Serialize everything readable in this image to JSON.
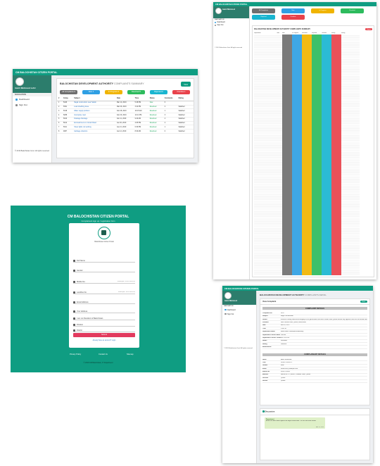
{
  "colors": {
    "brand": "#0f9d82",
    "gray": "#6f6f6f",
    "blue": "#2f9fe3",
    "yellow": "#f0b400",
    "green": "#2dbb5d",
    "cyan": "#19b5d0",
    "red": "#e8424b"
  },
  "app": {
    "title": "CM BALOCHISTAN CITIZEN PORTAL"
  },
  "panelA": {
    "user_name": "Aamir Mehmood Lehri",
    "menu_heading": "NAVIGATION",
    "menu": [
      "Dashboard",
      "Sign Out"
    ],
    "footer": "© 2019 Balochistan Govt. All rights reserved",
    "heading_main": "BALOCHISTAN DEVELOPMENT AUTHORITY",
    "heading_sub": "COMPLAINTS SUMMARY",
    "new_button": "New",
    "filters": [
      {
        "label": "All Complaints",
        "count": "9",
        "color": "#6f6f6f"
      },
      {
        "label": "New",
        "count": "1",
        "color": "#2f9fe3"
      },
      {
        "label": "In Progress",
        "count": "2",
        "color": "#f0b400"
      },
      {
        "label": "Resolved",
        "count": "5",
        "color": "#2dbb5d"
      },
      {
        "label": "Rejected",
        "count": "0",
        "color": "#19b5d0"
      },
      {
        "label": "Overdue",
        "count": "1",
        "color": "#e8424b"
      }
    ],
    "table": {
      "headers": [
        "#",
        "Comp.",
        "Subject",
        "Date",
        "Time",
        "Status",
        "Comments",
        "Rating"
      ],
      "rows": [
        [
          "1",
          "5426",
          "Illegal construction near Sariab",
          "Mar 14, 2019",
          "5:48 PM",
          "New",
          "0",
          ""
        ],
        [
          "2",
          "5391",
          "Load shedding issue",
          "Mar 09, 2019",
          "3:22 PM",
          "Resolved",
          "2",
          "Satisfied"
        ],
        [
          "3",
          "5318",
          "Water supply problem",
          "Feb 28, 2019",
          "10:15 AM",
          "Resolved",
          "1",
          "Satisfied"
        ],
        [
          "4",
          "5288",
          "Incomplete road",
          "Feb 20, 2019",
          "12:11 PM",
          "Resolved",
          "3",
          "Satisfied"
        ],
        [
          "5",
          "5190",
          "Drainage blockage",
          "Feb 11, 2019",
          "9:40 AM",
          "Resolved",
          "4",
          "Satisfied"
        ],
        [
          "6",
          "5102",
          "Encroachment on Jinnah Road",
          "Jan 30, 2019",
          "4:05 PM",
          "Resolved",
          "2",
          "Satisfied"
        ],
        [
          "7",
          "5011",
          "Street lights not working",
          "Jan 21, 2019",
          "6:30 PM",
          "Resolved",
          "1",
          "Satisfied"
        ],
        [
          "8",
          "4987",
          "Garbage collection",
          "Jan 12, 2019",
          "8:20 AM",
          "Resolved",
          "0",
          "Satisfied"
        ]
      ]
    }
  },
  "panelB": {
    "user_name": "Aamir Mehmood",
    "menu_heading": "NAVIGATION",
    "menu": [
      "Dashboard",
      "Sign Out"
    ],
    "footer": "© 2019 Balochistan Govt. All rights reserved",
    "filters": [
      {
        "label": "All Complaints",
        "color": "#6f6f6f"
      },
      {
        "label": "New",
        "color": "#2f9fe3"
      },
      {
        "label": "In Progress",
        "color": "#f0b400"
      },
      {
        "label": "Resolved",
        "color": "#2dbb5d"
      },
      {
        "label": "Rejected",
        "color": "#19b5d0"
      },
      {
        "label": "Overdue",
        "color": "#e8424b"
      }
    ],
    "heading": "BALOCHISTAN DEVELOPMENT AUTHORITY COMPLAINTS SUMMARY",
    "export_button": "Export",
    "columns": [
      "Department",
      "Total",
      "New",
      "In Progress",
      "Resolved",
      "Rejected",
      "Overdue",
      "Rating"
    ]
  },
  "panelC": {
    "title": "CM BALOCHISTAN CITIZEN PORTAL",
    "subtitle": "Complainant sign up / registration form",
    "logo_caption": "Balochistan Citizen Portal",
    "fields": [
      {
        "label": "Full Name",
        "value": ""
      },
      {
        "label": "Gender",
        "value": "Select Gender"
      },
      {
        "label": "Mobile No.",
        "value": "Example: 03xx-xxxxxxx"
      },
      {
        "label": "Landline No.",
        "value": "Example: 081-xxxxxxx"
      },
      {
        "label": "Email Address",
        "value": ""
      },
      {
        "label": "Your Address",
        "value": ""
      },
      {
        "label": "I am not Resident of Balochistan",
        "value": ""
      },
      {
        "label": "Division",
        "value": "Select Division"
      },
      {
        "label": "District",
        "value": "Select District"
      }
    ],
    "submit": "Submit",
    "already": "Already have an account? Login",
    "footer_links": [
      "Privacy Policy",
      "Contact Us",
      "Sitemap"
    ],
    "copyright": "© 2019 CM Balochistan, IT Department"
  },
  "panelD": {
    "user_name": "Aamir Mehmood",
    "menu_heading": "NAVIGATION",
    "menu": [
      "Dashboard",
      "Sign Out"
    ],
    "footer": "© 2019 Balochistan Govt. All rights reserved",
    "heading_main": "BALOCHISTAN DEVELOPMENT AUTHORITY",
    "heading_sub": "COMPLAINTS DETAIL",
    "view_title": "View Complaint",
    "back_button": "Back",
    "complaint_section": "COMPLAINT DETAILS",
    "complaint_rows": [
      [
        "Complaint No.",
        "5426"
      ],
      [
        "Subject",
        "Illegal Construction"
      ],
      [
        "Details",
        "A house is being constructed illegally on the government land near Sariab Road Quetta without any approval from the concerned authority. The construction is blocking the public way and needs immediate attention from BDA officials kindly take action as soon as possible."
      ],
      [
        "Location",
        "Near Sariab Road, Quetta, Balochistan"
      ],
      [
        "Date",
        "Mar 14, 2019"
      ],
      [
        "Time",
        "5:48 PM"
      ],
      [
        "Department Name",
        "Balochistan Development Authority"
      ],
      [
        "Department Officer Name",
        "Director"
      ],
      [
        "Department Officer Contact",
        "081-9201234"
      ],
      [
        "Status",
        "Resolved"
      ],
      [
        "Rating",
        "Satisfied"
      ],
      [
        "Attachments",
        ""
      ]
    ],
    "complainant_section": "COMPLAINANT DETAILS",
    "complainant_rows": [
      [
        "Name",
        "Aamir Mehmood"
      ],
      [
        "CNIC",
        "54400-1234567-1"
      ],
      [
        "Gender",
        "Male"
      ],
      [
        "Email",
        "aamir.lehri@example.com"
      ],
      [
        "Mobile No.",
        "0300-1234567"
      ],
      [
        "Address",
        "House No. 12, Block 4, Satellite Town, Quetta"
      ],
      [
        "Division",
        "Quetta"
      ],
      [
        "District",
        "Quetta"
      ]
    ],
    "discussion_title": "Discussion",
    "message": {
      "author": "Department",
      "text": "Action has been taken against the illegal construction. The site has been sealed.",
      "time": "Mar 15, 2019"
    }
  }
}
